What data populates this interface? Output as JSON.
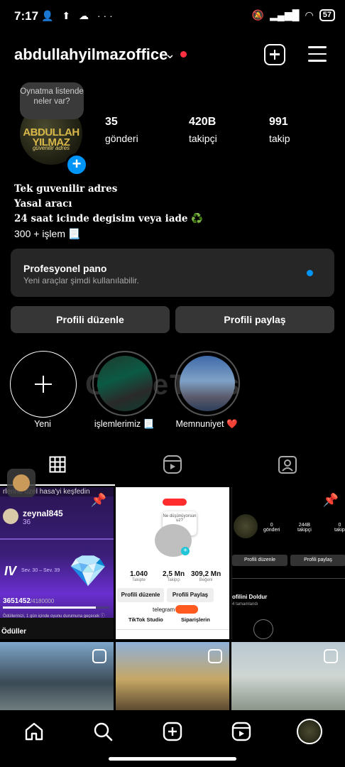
{
  "status_bar": {
    "time": "7:17",
    "battery": "57",
    "left_icons": "👤 ⬆ ☁ ···"
  },
  "header": {
    "username": "abdullahyilmazoffice"
  },
  "profile": {
    "note_bubble": "Oynatma listende neler var?",
    "avatar_logo_line1": "ABDULLAH",
    "avatar_logo_line2": "YILMAZ",
    "avatar_logo_line3": "güvenilir adres",
    "stats": [
      {
        "number": "35",
        "label": "gönderi"
      },
      {
        "number": "420B",
        "label": "takipçi"
      },
      {
        "number": "991",
        "label": "takip"
      }
    ],
    "bio_lines": [
      "Tek guvenilir adres",
      "Yasal aracı",
      "24 saat icinde degisim veya iade ♻️",
      "300 + işlem 📃"
    ]
  },
  "pro_panel": {
    "title": "Profesyonel pano",
    "subtitle": "Yeni araçlar şimdi kullanılabilir."
  },
  "buttons": {
    "edit": "Profili düzenle",
    "share": "Profili paylaş"
  },
  "highlights": [
    {
      "label": "Yeni"
    },
    {
      "label": "işlemlerimiz 📃"
    },
    {
      "label": "Memnuniyet ❤️"
    }
  ],
  "watermark": "GameTolis",
  "grid": {
    "post1": {
      "banner": "rlerine özel hasa'yi keşfedin",
      "user": "zeynal845",
      "gems": "36",
      "level": "IV",
      "dates": "Sev. 30 – Sev. 39",
      "progress": "3651452",
      "progress_total": "/4180000",
      "note": "Ödüllerinizi, 1 gün içinde oyunu durumuna geçecek ⓘ",
      "footer": "Ödüller"
    },
    "post2": {
      "bubble": "Ne düşünüyorsun uz?",
      "s1": "1.040",
      "s1l": "Takipte",
      "s2": "2,5 Mn",
      "s2l": "Takipçi",
      "s3": "309,2 Mn",
      "s3l": "Beğeni",
      "b1": "Profili düzenle",
      "b2": "Profili Paylaş",
      "tg": "telegram",
      "tiktok": "TikTok Studio",
      "orders": "Siparişlerin"
    },
    "post3": {
      "n1": "0",
      "l1": "gönderi",
      "n2": "244B",
      "l2": "takipçi",
      "n3": "0",
      "l3": "takip",
      "b1": "Profili düzenle",
      "b2": "Profili paylaş",
      "fill": "ofilini Doldur",
      "fill_sub": "4 tamamlandı"
    }
  },
  "colors": {
    "accent": "#0095f6",
    "notification": "#ff3040",
    "panel": "#262626",
    "button": "#363636"
  }
}
